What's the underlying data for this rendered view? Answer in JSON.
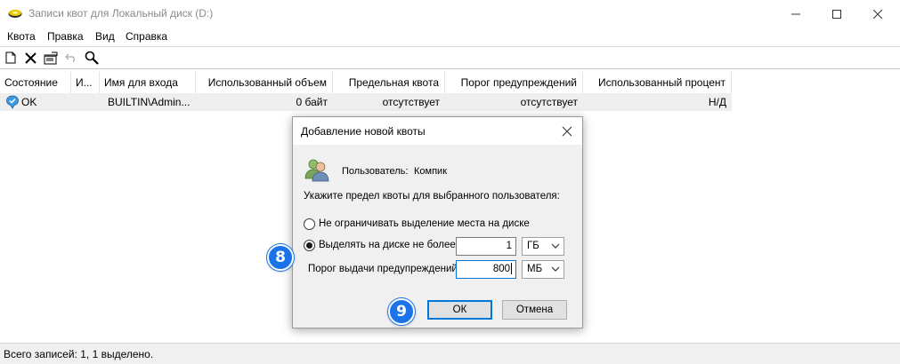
{
  "window": {
    "title": "Записи квот для Локальный диск (D:)",
    "controls": {
      "minimize": "minimize-icon",
      "maximize": "maximize-icon",
      "close": "close-icon"
    }
  },
  "menu": [
    "Квота",
    "Правка",
    "Вид",
    "Справка"
  ],
  "toolbar": [
    "new-entry-icon",
    "delete-icon",
    "properties-icon",
    "undo-icon",
    "find-icon"
  ],
  "list": {
    "columns": [
      "Состояние",
      "И...",
      "Имя для входа",
      "Использованный объем",
      "Предельная квота",
      "Порог предупреждений",
      "Использованный процент"
    ],
    "rows": [
      {
        "status": "OK",
        "name": "",
        "login": "BUILTIN\\Admin...",
        "used": "0 байт",
        "limit": "отсутствует",
        "warning": "отсутствует",
        "percent": "Н/Д"
      }
    ]
  },
  "status_bar": {
    "text": "Всего записей: 1, 1 выделено."
  },
  "dialog": {
    "title": "Добавление новой квоты",
    "user_label": "Пользователь:",
    "user_value": "Компик",
    "instruction": "Укажите предел квоты для выбранного пользователя:",
    "option_unlimited": "Не ограничивать выделение места на диске",
    "option_limit": "Выделять на диске не более",
    "limit_value": "1",
    "limit_unit": "ГБ",
    "warning_label": "Порог выдачи предупреждений",
    "warning_value": "800",
    "warning_unit": "МБ",
    "ok": "ОК",
    "cancel": "Отмена",
    "selected_option": "limit"
  },
  "badges": {
    "step8": "8",
    "step9": "9"
  },
  "colors": {
    "badge": "#1a73e8",
    "focus": "#0078d7",
    "selection": "#eeeeee"
  }
}
